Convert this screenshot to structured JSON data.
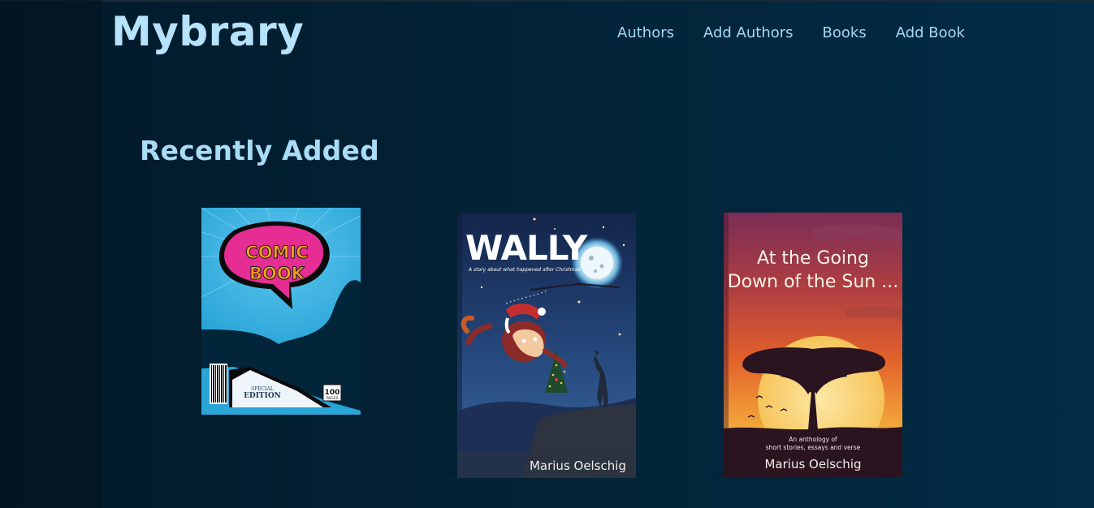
{
  "header": {
    "logo": "Mybrary",
    "nav": [
      "Authors",
      "Add Authors",
      "Books",
      "Add Book"
    ]
  },
  "main": {
    "section_title": "Recently Added",
    "books": [
      {
        "cover_title_line1": "COMIC",
        "cover_title_line2": "BOOK",
        "badge_line1": "SPECIAL",
        "badge_line2": "EDITION",
        "pages_number": "100",
        "pages_label": "PAGES"
      },
      {
        "cover_title": "WALLY",
        "subtitle": "A story about what happened after Christmas",
        "author": "Marius Oelschig"
      },
      {
        "cover_title_line1": "At the Going",
        "cover_title_line2": "Down of the Sun ...",
        "tagline_line1": "An anthology of",
        "tagline_line2": "short stories, essays and verse",
        "author": "Marius Oelschig"
      }
    ]
  },
  "colors": {
    "logo": "#b6e2fb",
    "nav": "#a5d8f4",
    "background": "#032438"
  }
}
